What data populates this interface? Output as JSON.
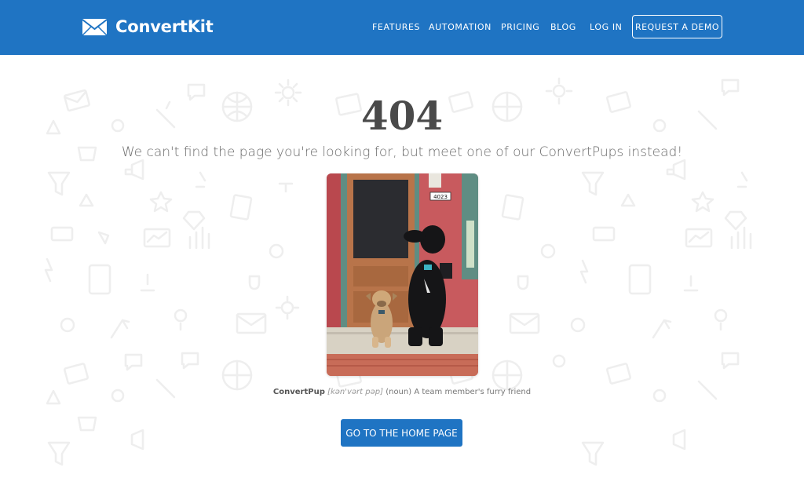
{
  "header": {
    "brand": "ConvertKit",
    "nav": [
      {
        "label": "FEATURES"
      },
      {
        "label": "AUTOMATION"
      },
      {
        "label": "PRICING"
      },
      {
        "label": "BLOG"
      },
      {
        "label": "LOG IN"
      }
    ],
    "cta": "REQUEST A DEMO"
  },
  "main": {
    "error_code": "404",
    "message": "We can't find the page you're looking for, but meet one of our ConvertPups instead!",
    "photo": {
      "house_number": "4023"
    },
    "caption": {
      "term": "ConvertPup",
      "pronunciation": "[kən'vərt pəp]",
      "definition": "(noun) A team member's furry friend"
    },
    "home_button": "GO TO THE HOME PAGE"
  },
  "colors": {
    "brand_blue": "#1f74c3",
    "heading": "#4a4a4a",
    "pattern": "#f1f1f1"
  }
}
